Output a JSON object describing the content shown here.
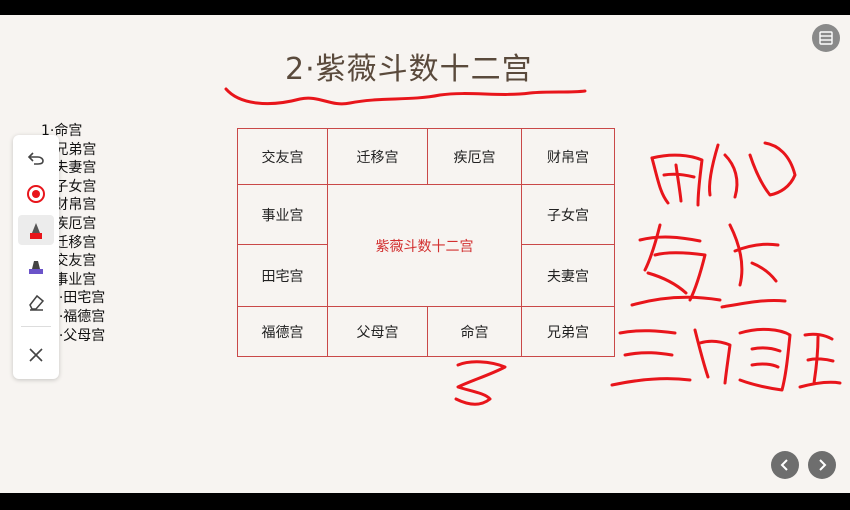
{
  "slide": {
    "title": "2·紫薇斗数十二宫",
    "list_items": [
      "1·命宫",
      "2·兄弟宫",
      "3·夫妻宫",
      "4·子女宫",
      "5·财帛宫",
      "6·疾厄宫",
      "7·迁移宫",
      "8·交友宫",
      "9·事业宫",
      "10·田宅宫",
      "11·福德宫",
      "12·父母宫"
    ],
    "grid": {
      "top_row": [
        "交友宫",
        "迁移宫",
        "疾厄宫",
        "财帛宫"
      ],
      "left_col": [
        "事业宫",
        "田宅宫"
      ],
      "right_col": [
        "子女宫",
        "夫妻宫"
      ],
      "bottom_row": [
        "福德宫",
        "父母宫",
        "命宫",
        "兄弟宫"
      ],
      "center": "紫薇斗数十二宫"
    }
  },
  "toolbar": {
    "tools": [
      "undo-icon",
      "laser-pointer-icon",
      "red-pen-icon",
      "highlighter-icon",
      "eraser-icon",
      "close-icon"
    ]
  },
  "colors": {
    "slide_bg": "#f7f4f1",
    "grid_border": "#c94848",
    "ink": "#e8151b",
    "title": "#5a4a3c"
  }
}
